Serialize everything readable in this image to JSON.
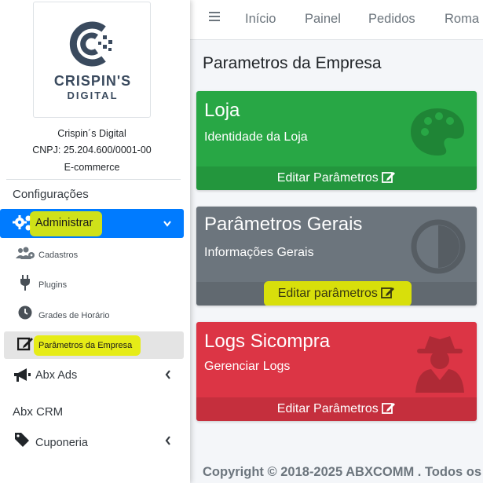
{
  "colors": {
    "primary": "#007bff",
    "success": "#28a745",
    "secondary": "#6c757d",
    "danger": "#dc3545",
    "highlight": "#e5ec00"
  },
  "sidebar": {
    "logo": {
      "line1": "CRISPIN'S",
      "line2": "DIGITAL"
    },
    "company": {
      "name": "Crispin´s Digital",
      "cnpj": "CNPJ: 25.204.600/0001-00",
      "type": "E-commerce"
    },
    "section_config": "Configurações",
    "admin": {
      "label": "Administrar",
      "icon": "gears-icon",
      "chevron": "chevron-down-icon"
    },
    "subitems": [
      {
        "label": "Cadastros",
        "icon": "users-cog-icon"
      },
      {
        "label": "Plugins",
        "icon": "plug-icon"
      },
      {
        "label": "Grades de Horário",
        "icon": "clock-icon"
      },
      {
        "label": "Parâmetros da Empresa",
        "icon": "edit-icon"
      }
    ],
    "abx_ads": {
      "label": "Abx Ads",
      "icon": "megaphone-icon"
    },
    "section_crm": "Abx CRM",
    "cuponeria": {
      "label": "Cuponeria",
      "icon": "tag-icon"
    }
  },
  "topnav": {
    "menu_icon": "hamburger-icon",
    "links": [
      "Início",
      "Painel",
      "Pedidos",
      "Roma"
    ]
  },
  "page_title": "Parametros da Empresa",
  "cards": [
    {
      "title": "Loja",
      "subtitle": "Identidade da Loja",
      "footer": "Editar Parâmetros",
      "icon": "palette-icon"
    },
    {
      "title": "Parâmetros Gerais",
      "subtitle": "Informações Gerais",
      "footer": "Editar parâmetros",
      "icon": "adjust-icon"
    },
    {
      "title": "Logs Sicompra",
      "subtitle": "Gerenciar Logs",
      "footer": "Editar Parâmetros",
      "icon": "user-secret-icon"
    }
  ],
  "footer": {
    "copyright": "Copyright © 2018-2025 ABXCOMM . Todos os"
  }
}
